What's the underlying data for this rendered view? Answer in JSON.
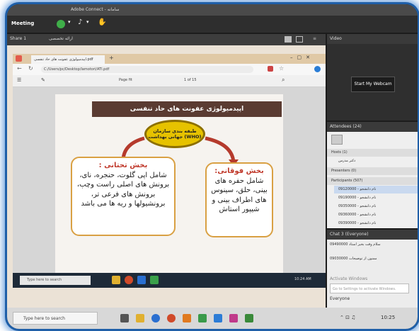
{
  "titlebar": {
    "text": "Adobe Connect - سامانه"
  },
  "meeting": {
    "label": "Meeting"
  },
  "share_pod": {
    "title": "Share 1",
    "subtitle": "ارائه تخصصی"
  },
  "video_pod": {
    "title": "Video",
    "button": "Start My Webcam"
  },
  "attendees_pod": {
    "title": "Attendees (24)",
    "hosts_label": "Hosts (1)",
    "presenters_label": "Presenters (0)",
    "participants_label": "Participants (507)",
    "rows": [
      "دکتر مدرس",
      "09120000 - نام دانشجو",
      "09190000 - نام دانشجو",
      "09350000 - نام دانشجو",
      "09360000 - نام دانشجو",
      "09390000 - نام دانشجو"
    ]
  },
  "chat_pod": {
    "title": "Chat 3 (Everyone)",
    "messages": [
      "سلام وقت بخیر استاد 09490000",
      "ممنون از توضیحات 09030000"
    ],
    "windows_notice": "Activate Windows",
    "windows_sub": "Go to Settings to activate Windows.",
    "input_label": "Everyone"
  },
  "browser": {
    "tab_label": "اپیدمیولوژی عفونت های حاد تنفسی.pdf",
    "url": "C:/Users/pc/Desktop/lamotori/ATI.pdf",
    "zoom": "Page fit",
    "page_counter": "1 of 15"
  },
  "slide": {
    "title": "اپیدمیولوژی عفونت های حاد تنفسی",
    "center_text": "طبقه بندی سازمان جهانی بهداشت (WHO)",
    "left_heading": "بخش تحتانی :",
    "left_body": "شامل اپی گلوت، حنجره، نای، برونش های اصلی راست وچپ، برونش های فرعی تر، برونشیولها و ریه ها می باشد",
    "right_heading": "بخش فوقانی:",
    "right_body": "شامل حفره های بینی، حلق، سینوس های اطراف بینی و شیپور استاش"
  },
  "inner_taskbar": {
    "search": "Type here to search",
    "time": "10:24 AM"
  },
  "host_taskbar": {
    "search": "Type here to search",
    "time": "10:25"
  }
}
